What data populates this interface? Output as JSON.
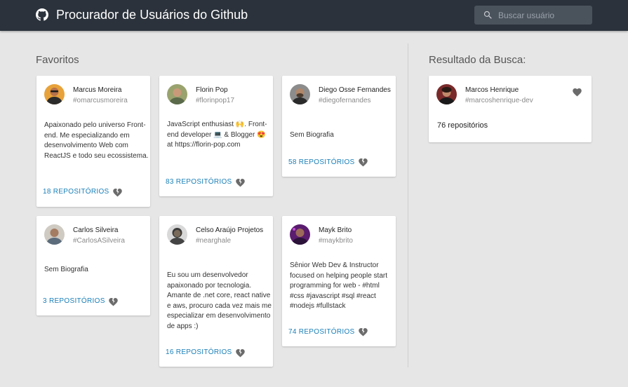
{
  "header": {
    "title": "Procurador de Usuários do Github",
    "search_placeholder": "Buscar usuário",
    "search_value": ""
  },
  "favorites": {
    "title": "Favoritos",
    "users": [
      {
        "name": "Marcus Moreira",
        "login": "#omarcusmoreira",
        "bio": "Apaixonado pelo universo Front-end. Me especializando em desenvolvimento Web com ReactJS e todo seu ecossistema.",
        "repos": "18 REPOSITÓRIOS"
      },
      {
        "name": "Florin Pop",
        "login": "#florinpop17",
        "bio": "JavaScript enthusiast 🙌. Front-end developer 💻 & Blogger 😍 at https://florin-pop.com",
        "repos": "83 REPOSITÓRIOS"
      },
      {
        "name": "Diego Osse Fernandes",
        "login": "#diegofernandes",
        "bio": "Sem Biografia",
        "repos": "58 REPOSITÓRIOS"
      },
      {
        "name": "Carlos Silveira",
        "login": "#CarlosASilveira",
        "bio": "Sem Biografia",
        "repos": "3 REPOSITÓRIOS"
      },
      {
        "name": "Celso Araújo Projetos",
        "login": "#nearghale",
        "bio": "Eu sou um desenvolvedor apaixonado por tecnologia. Amante de .net core, react native e aws, procuro cada vez mais me especializar em desenvolvimento de apps :)",
        "repos": "16 REPOSITÓRIOS"
      },
      {
        "name": "Mayk Brito",
        "login": "#maykbrito",
        "bio": "Sênior Web Dev & Instructor focused on helping people start programming for web - #html #css #javascript #sql #react #nodejs #fullstack",
        "repos": "74 REPOSITÓRIOS"
      }
    ]
  },
  "results": {
    "title": "Resultado da Busca:",
    "user": {
      "name": "Marcos Henrique",
      "login": "#marcoshenrique-dev",
      "repos": "76 repositórios"
    }
  },
  "icons": {
    "logo": "github-icon",
    "search": "search-icon",
    "unfavorite": "broken-heart-icon",
    "favorite": "heart-icon"
  },
  "colors": {
    "topbar": "#2b323b",
    "link": "#1a7fb8",
    "heart": "#6b6b6b",
    "background": "#e6e6e6"
  }
}
